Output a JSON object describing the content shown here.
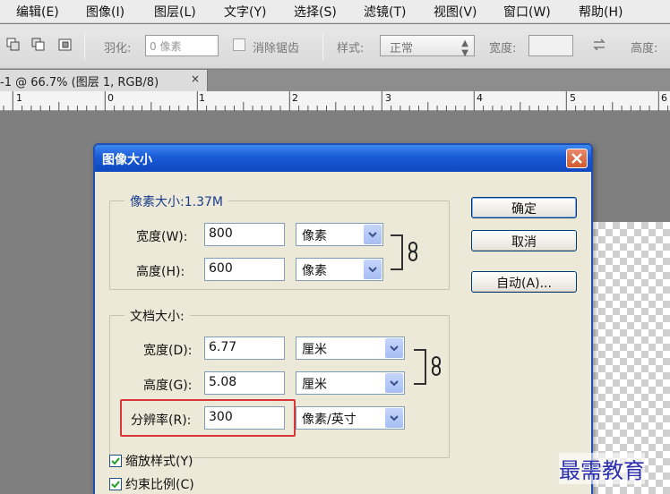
{
  "menu": [
    "编辑(E)",
    "图像(I)",
    "图层(L)",
    "文字(Y)",
    "选择(S)",
    "滤镜(T)",
    "视图(V)",
    "窗口(W)",
    "帮助(H)"
  ],
  "options": {
    "feather_label": "羽化:",
    "feather_placeholder": "0 像素",
    "antialias_label": "消除锯齿",
    "style_label": "样式:",
    "style_value": "正常",
    "width_label": "宽度:",
    "height_label": "高度:"
  },
  "document_tab": {
    "title": "-1 @ 66.7% (图层 1, RGB/8)",
    "close": "×"
  },
  "ruler": [
    "1",
    "0",
    "1",
    "2",
    "3",
    "4",
    "5",
    "6"
  ],
  "dialog": {
    "title": "图像大小",
    "pixel_group": {
      "legend": "像素大小:1.37M",
      "width_label": "宽度(W):",
      "width_value": "800",
      "width_unit": "像素",
      "height_label": "高度(H):",
      "height_value": "600",
      "height_unit": "像素"
    },
    "doc_group": {
      "legend": "文档大小:",
      "width_label": "宽度(D):",
      "width_value": "6.77",
      "width_unit": "厘米",
      "height_label": "高度(G):",
      "height_value": "5.08",
      "height_unit": "厘米",
      "res_label": "分辨率(R):",
      "res_value": "300",
      "res_unit": "像素/英寸"
    },
    "buttons": {
      "ok": "确定",
      "cancel": "取消",
      "auto": "自动(A)..."
    },
    "checks": {
      "scale_styles": "缩放样式(Y)",
      "constrain": "约束比例(C)"
    }
  },
  "watermark": "最需教育",
  "colors": {
    "title_blue": "#1a5ad6",
    "highlight_red": "#d9363a",
    "dialog_bg": "#ece9d8"
  }
}
